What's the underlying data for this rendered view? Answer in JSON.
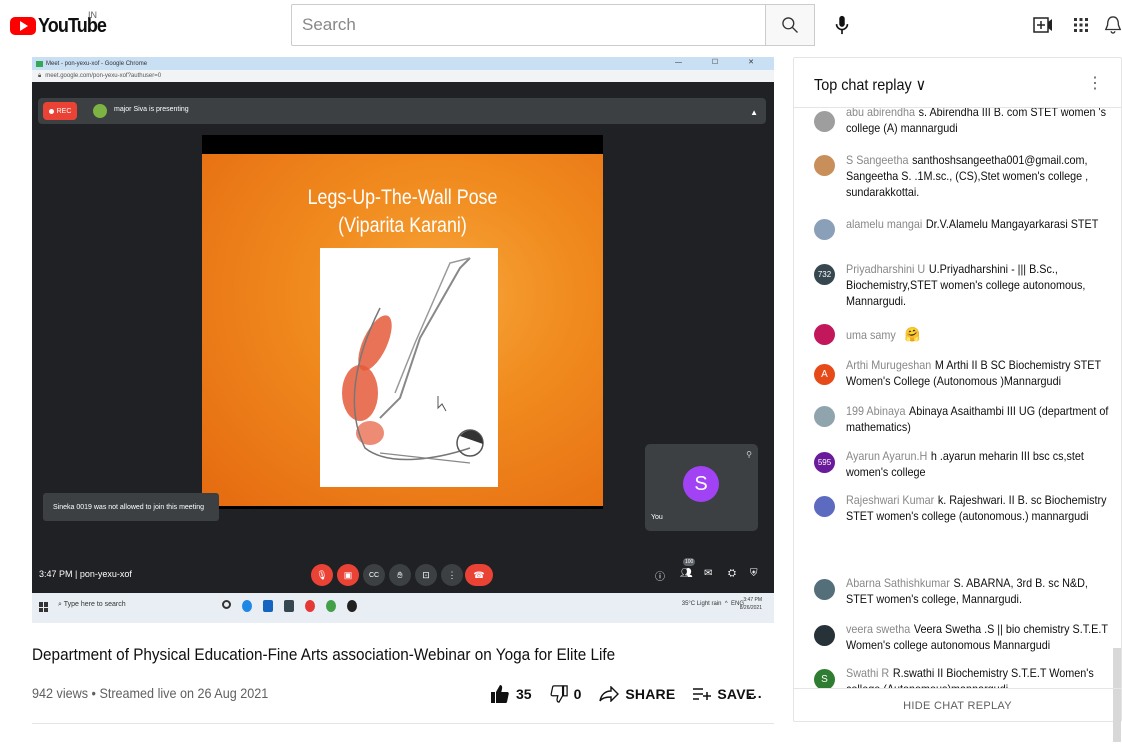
{
  "masthead": {
    "logo_text": "YouTube",
    "region": "IN",
    "search_placeholder": "Search"
  },
  "player": {
    "chrome_title": "Meet - pon-yexu-xof - Google Chrome",
    "address": "meet.google.com/pon-yexu-xof?authuser=0",
    "rec_label": "REC",
    "presenting_text": "major Siva is presenting",
    "slide_title_line1": "Legs-Up-The-Wall Pose",
    "slide_title_line2": "(Viparita Karani)",
    "toast": "Sineka 0019 was not allowed to join this meeting",
    "self_initial": "S",
    "self_label": "You",
    "meet_time": "3:47 PM  |  pon-yexu-xof",
    "participants_badge": "100",
    "taskbar_search": "Type here to search",
    "taskbar_weather": "35°C  Light rain",
    "taskbar_lang": "ENG",
    "taskbar_time": "3:47 PM",
    "taskbar_date": "8/26/2021"
  },
  "video": {
    "title": "Department of Physical Education-Fine Arts association-Webinar on Yoga for Elite Life",
    "meta": "942 views • Streamed live on 26 Aug 2021",
    "likes": "35",
    "dislikes": "0",
    "share_label": "SHARE",
    "save_label": "SAVE",
    "more_label": "..."
  },
  "chat": {
    "header": "Top chat replay",
    "footer": "HIDE CHAT REPLAY",
    "messages": [
      {
        "author": "abu abirendha",
        "text": "s. Abirendha III B. com STET women 's college (A) mannargudi",
        "avatar": "",
        "color": "#9e9e9e"
      },
      {
        "author": "S Sangeetha",
        "text": "santhoshsangeetha001@gmail.com, Sangeetha S. .1M.sc., (CS),Stet women's college , sundarakkottai.",
        "avatar": "",
        "color": "#c98f5a"
      },
      {
        "author": "alamelu mangai",
        "text": "Dr.V.Alamelu Mangayarkarasi STET",
        "avatar": "",
        "color": "#8aa0b8"
      },
      {
        "author": "Priyadharshini U",
        "text": "U.Priyadharshini - ||| B.Sc., Biochemistry,STET women's college autonomous, Mannargudi.",
        "avatar": "732",
        "color": "#37474f"
      },
      {
        "author": "uma samy",
        "text": "",
        "avatar": "",
        "color": "#c2185b"
      },
      {
        "author": "Arthi Murugeshan",
        "text": "M Arthi II B SC Biochemistry STET Women's College (Autonomous )Mannargudi",
        "avatar": "A",
        "color": "#e64a19"
      },
      {
        "author": "199 Abinaya",
        "text": "Abinaya Asaithambi III UG (department of mathematics)",
        "avatar": "",
        "color": "#90a4ae"
      },
      {
        "author": "Ayarun Ayarun.H",
        "text": "h .ayarun meharin III bsc cs,stet women's college",
        "avatar": "595",
        "color": "#6a1b9a"
      },
      {
        "author": "Rajeshwari Kumar",
        "text": "k. Rajeshwari. II B. sc Biochemistry STET women's college (autonomous.) mannargudi",
        "avatar": "",
        "color": "#5c6bc0"
      },
      {
        "author": "Abarna Sathishkumar",
        "text": "S. ABARNA, 3rd B. sc N&D, STET women's college, Mannargudi.",
        "avatar": "",
        "color": "#546e7a"
      },
      {
        "author": "veera swetha",
        "text": "Veera Swetha .S || bio chemistry S.T.E.T Women's college autonomous Mannargudi",
        "avatar": "",
        "color": "#263238"
      },
      {
        "author": "Swathi R",
        "text": "R.swathi II Biochemistry S.T.E.T Women's college (Autonomous)mannargudi",
        "avatar": "S",
        "color": "#2e7d32"
      }
    ]
  },
  "colors": {
    "youtube_red": "#ff0000",
    "meet_dark": "#202124",
    "meet_red": "#ea4335",
    "slide_orange": "#f08a1e"
  },
  "icons": {
    "search": "search-icon",
    "mic": "mic-icon",
    "create": "create-video-icon",
    "apps": "apps-grid-icon",
    "notifications": "bell-icon",
    "like": "thumb-up-icon",
    "dislike": "thumb-down-icon",
    "share": "share-icon",
    "save": "add-to-playlist-icon"
  }
}
